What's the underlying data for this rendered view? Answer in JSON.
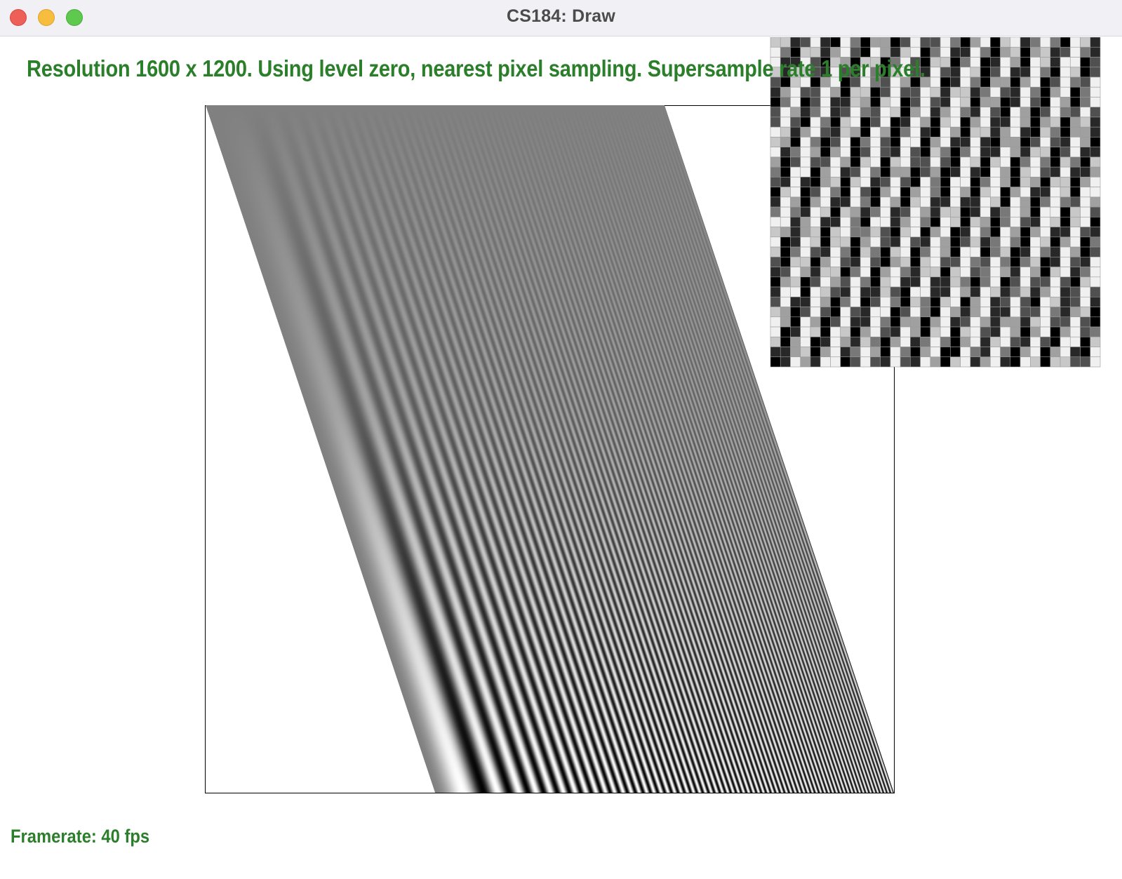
{
  "window": {
    "title": "CS184: Draw"
  },
  "canvas": {
    "status_text": "Resolution 1600 x 1200. Using level zero, nearest pixel sampling. Supersample rate 1 per pixel.",
    "framerate_text": "Framerate: 40 fps",
    "resolution": [
      1600,
      1200
    ],
    "mipmap_level": "zero",
    "sampling": "nearest pixel",
    "supersample_rate": 1,
    "framerate_fps": 40
  },
  "colors": {
    "status_text": "#2b7f2b",
    "title_text": "#4b4b4b",
    "titlebar_bg": "#f1f0f5",
    "close_button": "#ee5f58",
    "minimize_button": "#f7bd3e",
    "maximize_button": "#5fc84f"
  }
}
